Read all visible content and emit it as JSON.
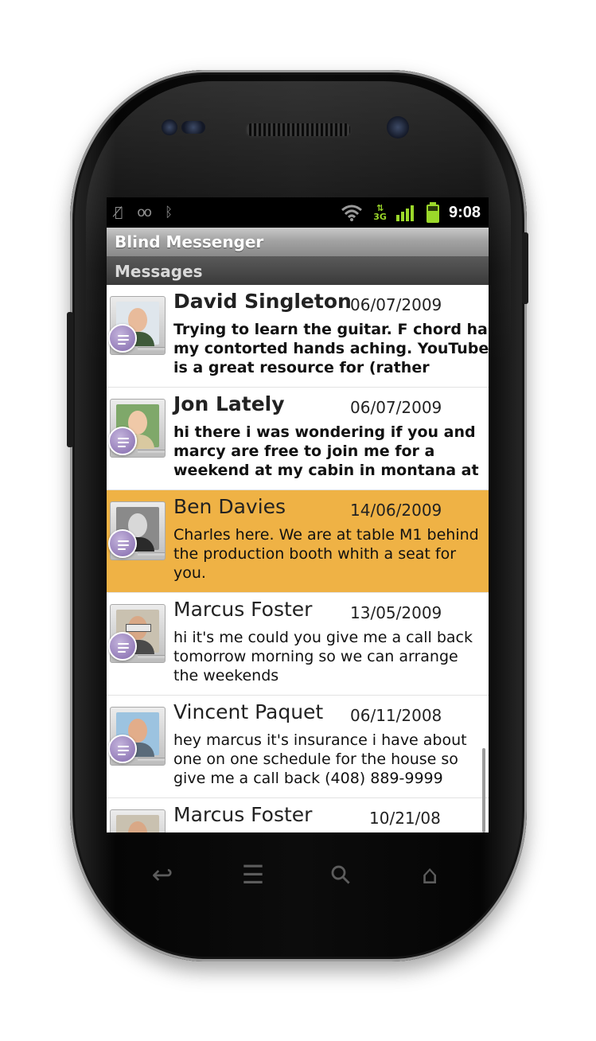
{
  "status": {
    "time": "9:08",
    "left_icons": [
      "mic-muted-icon",
      "voicemail-icon",
      "bluetooth-icon"
    ],
    "right_icons": [
      "wifi-icon",
      "3g-data-icon",
      "signal-icon",
      "battery-icon"
    ],
    "network_label": "3G"
  },
  "app": {
    "title": "Blind Messenger"
  },
  "section": {
    "title": "Messages"
  },
  "messages": [
    {
      "name": "David Singleton",
      "date": "06/07/2009",
      "unread": true,
      "preview": [
        "Trying to learn the guitar. F chord has",
        "my contorted hands aching. YouTube",
        "is a great resource for (rather"
      ]
    },
    {
      "name": "Jon Lately",
      "date": "06/07/2009",
      "unread": true,
      "preview": [
        "hi there i was wondering if you and",
        "marcy are free to join me for a",
        "weekend at my cabin in montana at"
      ]
    },
    {
      "name": "Ben Davies",
      "date": "14/06/2009",
      "unread": false,
      "selected": true,
      "preview": [
        "Charles here. We are at table M1 behind",
        "the production booth whith a seat for",
        "you."
      ]
    },
    {
      "name": "Marcus Foster",
      "date": "13/05/2009",
      "unread": false,
      "preview": [
        "hi it's me could you give me a call back",
        "tomorrow morning so we can arrange",
        "the weekends"
      ]
    },
    {
      "name": "Vincent Paquet",
      "date": "06/11/2008",
      "unread": false,
      "preview": [
        "hey marcus it's insurance i have about",
        "one on one schedule for the house so",
        "give me a call back (408) 889-9999"
      ]
    },
    {
      "name": "Marcus Foster",
      "date": "10/21/08",
      "unread": false,
      "preview": [
        "",
        "",
        ""
      ]
    }
  ],
  "colors": {
    "selected_row": "#efb245",
    "badge": "#8268ac",
    "title_bar": "#a3a3a3"
  },
  "nav_icons": [
    "back-icon",
    "menu-icon",
    "search-icon",
    "home-icon"
  ],
  "nav_glyphs": {
    "back": "↩",
    "menu": "☰",
    "search": "⚲",
    "home": "⌂"
  }
}
